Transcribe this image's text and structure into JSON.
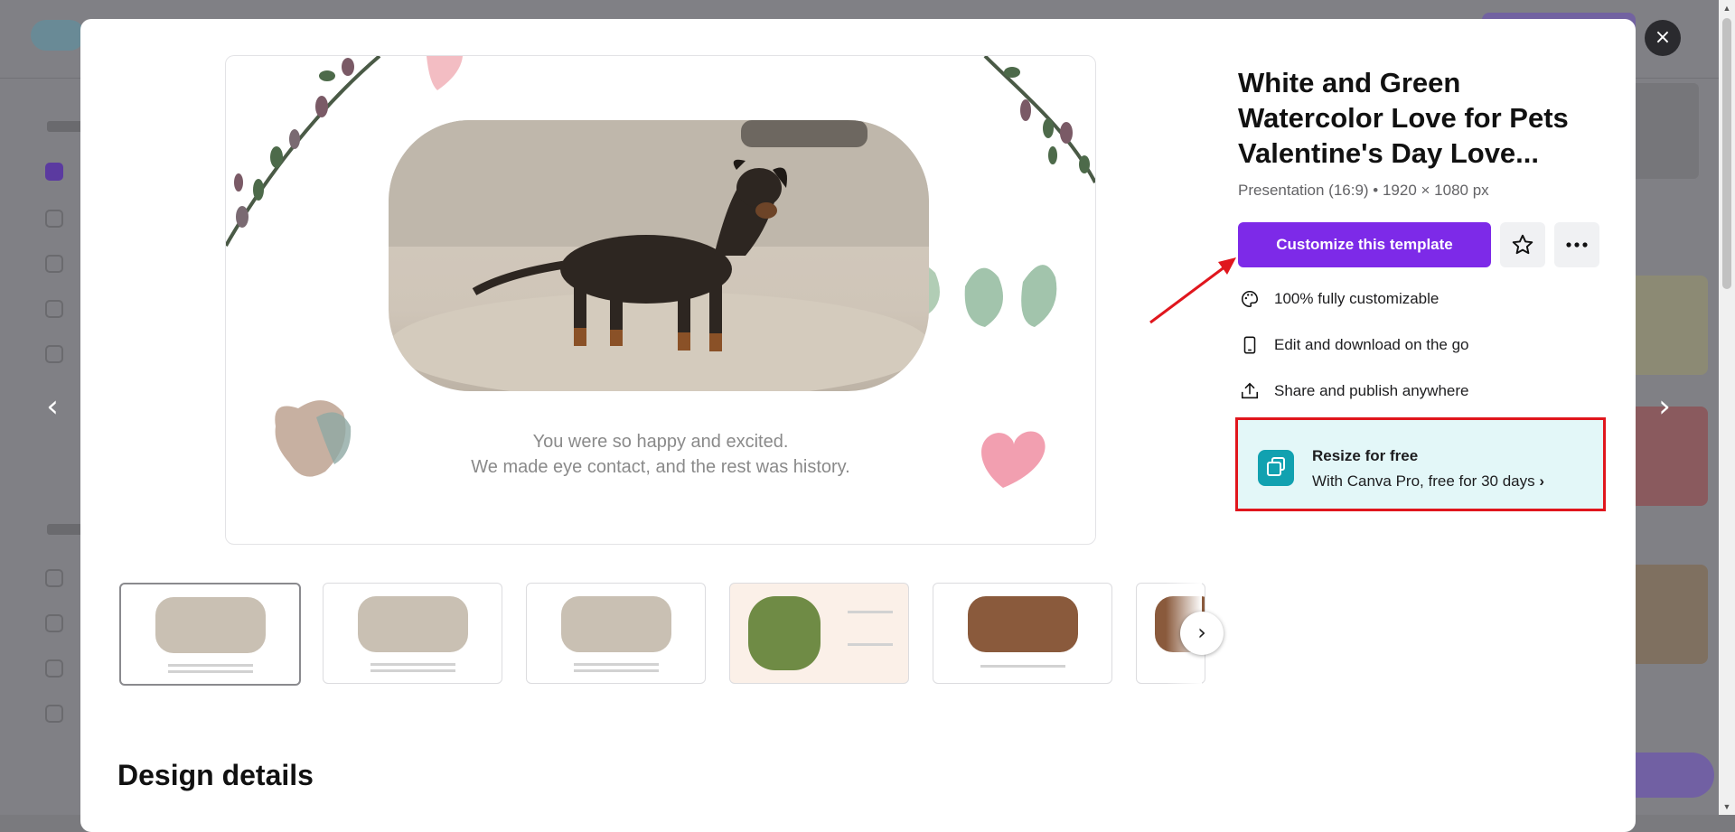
{
  "template": {
    "title": "White and Green Watercolor Love for Pets Valentine's Day Love...",
    "meta": "Presentation (16:9) • 1920 × 1080 px",
    "customize_label": "Customize this template",
    "caption_line1": "You were so happy and excited.",
    "caption_line2": "We made eye contact, and the rest was history."
  },
  "features": [
    {
      "icon": "palette-icon",
      "label": "100% fully customizable"
    },
    {
      "icon": "phone-icon",
      "label": "Edit and download on the go"
    },
    {
      "icon": "share-icon",
      "label": "Share and publish anywhere"
    }
  ],
  "resize": {
    "title": "Resize for free",
    "subtitle": "With Canva Pro, free for 30 days",
    "chevron": "›"
  },
  "glyphs": {
    "close": "×",
    "prev": "‹",
    "next": "›",
    "more": "•••",
    "star": "☆"
  },
  "thumbnails": [
    {
      "name": "slide-1",
      "active": true
    },
    {
      "name": "slide-2",
      "active": false
    },
    {
      "name": "slide-3",
      "active": false
    },
    {
      "name": "slide-4",
      "active": false
    },
    {
      "name": "slide-5",
      "active": false
    },
    {
      "name": "slide-6",
      "active": false
    }
  ],
  "sections": {
    "design_details": "Design details"
  },
  "colors": {
    "accent": "#7d2ae8",
    "highlight_border": "#e0161d",
    "resize_bg": "#e3f7f8",
    "annotation_arrow": "#e0161d"
  }
}
